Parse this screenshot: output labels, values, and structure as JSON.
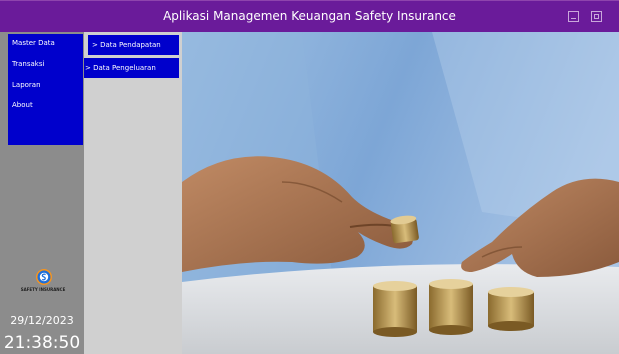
{
  "window": {
    "title": "Aplikasi Managemen Keuangan Safety Insurance"
  },
  "sidebar": {
    "menu": [
      {
        "label": "Master Data"
      },
      {
        "label": "Transaksi"
      },
      {
        "label": "Laporan"
      },
      {
        "label": "About"
      }
    ],
    "logo_text": "SAFETY INSURANCE",
    "date": "29/12/2023",
    "time": "21:38:50"
  },
  "submenu": {
    "items": [
      {
        "label": "> Data Pendapatan"
      },
      {
        "label": "> Data Pengeluaran"
      }
    ]
  },
  "colors": {
    "titlebar": "#6a1b9a",
    "menu": "#0000cc",
    "sidebar": "#8c8c8c",
    "submenu_panel": "#d0d0d0"
  }
}
